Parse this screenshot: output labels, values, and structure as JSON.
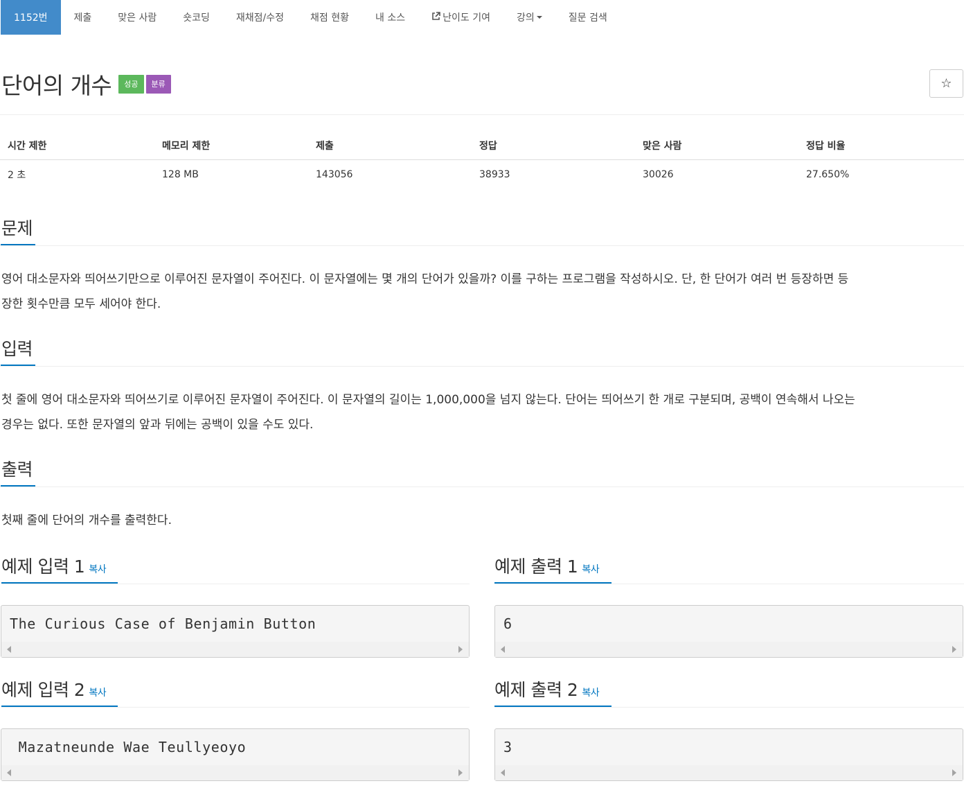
{
  "nav": {
    "items": [
      {
        "label": "1152번",
        "active": true
      },
      {
        "label": "제출"
      },
      {
        "label": "맞은 사람"
      },
      {
        "label": "숏코딩"
      },
      {
        "label": "재채점/수정"
      },
      {
        "label": "채점 현황"
      },
      {
        "label": "내 소스"
      },
      {
        "label": "난이도 기여",
        "icon": "external-link-icon"
      },
      {
        "label": "강의",
        "icon": "caret-down-icon"
      },
      {
        "label": "질문 검색"
      }
    ]
  },
  "problem": {
    "title": "단어의 개수",
    "badges": [
      {
        "label": "성공",
        "color": "#5cb85c"
      },
      {
        "label": "분류",
        "color": "#9b59b6"
      }
    ],
    "star": "☆"
  },
  "info": {
    "headers": [
      "시간 제한",
      "메모리 제한",
      "제출",
      "정답",
      "맞은 사람",
      "정답 비율"
    ],
    "values": [
      "2 초",
      "128 MB",
      "143056",
      "38933",
      "30026",
      "27.650%"
    ]
  },
  "sections": {
    "description": {
      "heading": "문제",
      "lines": [
        "영어 대소문자와 띄어쓰기만으로 이루어진 문자열이 주어진다. 이 문자열에는 몇 개의 단어가 있을까? 이를 구하는 프로그램을 작성하시오. 단, 한 단어가 여러 번 등장하면 등",
        "장한 횟수만큼 모두 세어야 한다."
      ]
    },
    "input": {
      "heading": "입력",
      "lines": [
        "첫 줄에 영어 대소문자와 띄어쓰기로 이루어진 문자열이 주어진다. 이 문자열의 길이는 1,000,000을 넘지 않는다. 단어는 띄어쓰기 한 개로 구분되며, 공백이 연속해서 나오는",
        "경우는 없다. 또한 문자열의 앞과 뒤에는 공백이 있을 수도 있다."
      ]
    },
    "output": {
      "heading": "출력",
      "lines": [
        "첫째 줄에 단어의 개수를 출력한다."
      ]
    }
  },
  "samples": {
    "copy_label": "복사",
    "input1": {
      "heading": "예제 입력 1",
      "code": "The Curious Case of Benjamin Button"
    },
    "output1": {
      "heading": "예제 출력 1",
      "code": "6"
    },
    "input2": {
      "heading": "예제 입력 2",
      "code": " Mazatneunde Wae Teullyeoyo"
    },
    "output2": {
      "heading": "예제 출력 2",
      "code": "3"
    }
  },
  "colors": {
    "accent": "#428bca",
    "link": "#0076c0",
    "success": "#5cb85c",
    "category": "#9b59b6"
  }
}
